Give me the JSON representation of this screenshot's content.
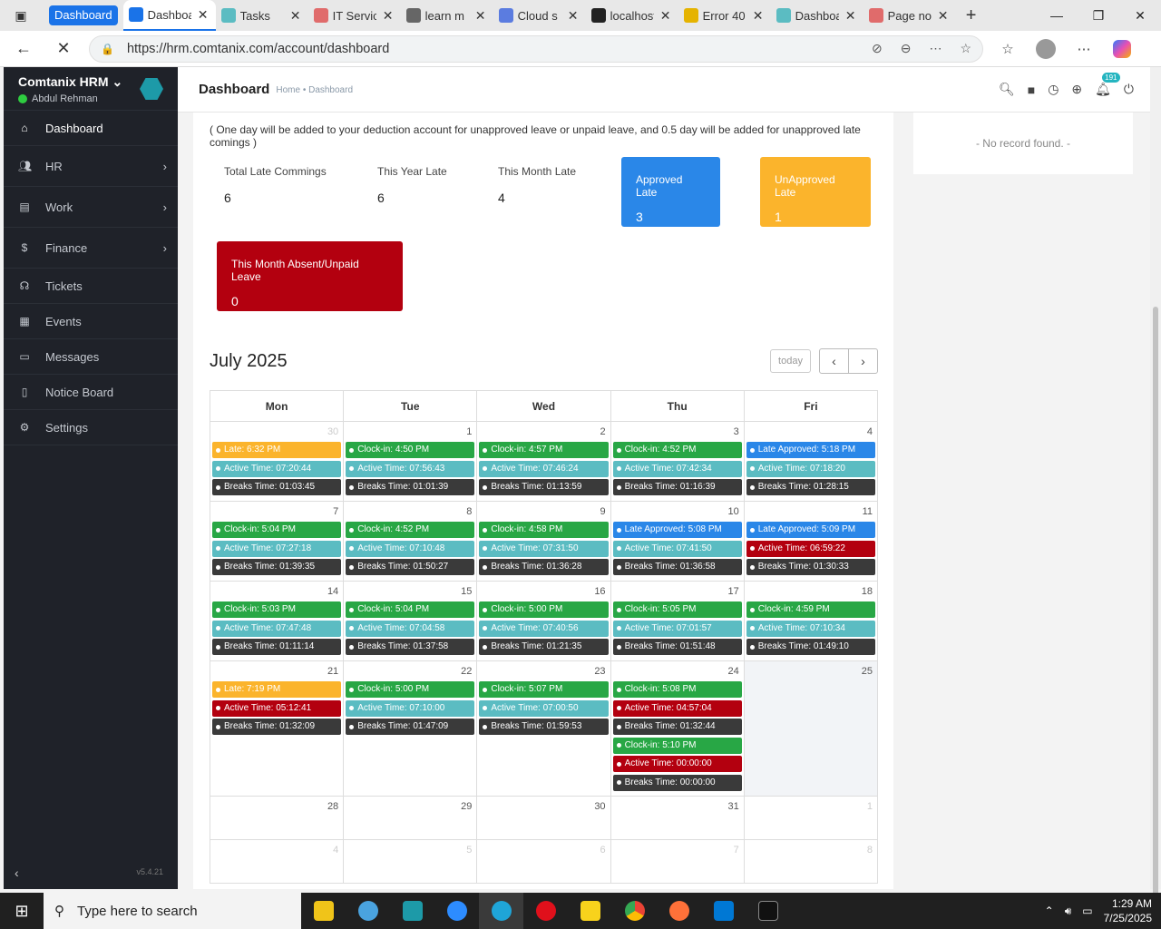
{
  "browser": {
    "tab_group_label": "Dashboard",
    "tabs": [
      {
        "label": "Dashboard",
        "icon": "dashboard-favicon",
        "active": true
      },
      {
        "label": "Tasks",
        "icon": "tasks-favicon"
      },
      {
        "label": "IT Service",
        "icon": "it-service-favicon"
      },
      {
        "label": "learn m",
        "icon": "learn-favicon"
      },
      {
        "label": "Cloud s",
        "icon": "cloud-favicon"
      },
      {
        "label": "localhost",
        "icon": "github-favicon"
      },
      {
        "label": "Error 40",
        "icon": "error-favicon"
      },
      {
        "label": "Dashboard",
        "icon": "dashboard-favicon-2"
      },
      {
        "label": "Page no",
        "icon": "page-favicon"
      }
    ],
    "url": "https://hrm.comtanix.com/account/dashboard"
  },
  "sidebar": {
    "app_name": "Comtanix HRM",
    "user_name": "Abdul Rehman",
    "items": [
      {
        "label": "Dashboard",
        "icon": "home-icon",
        "active": true
      },
      {
        "label": "HR",
        "icon": "users-icon",
        "submenu": true
      },
      {
        "label": "Work",
        "icon": "briefcase-icon",
        "submenu": true
      },
      {
        "label": "Finance",
        "icon": "dollar-icon",
        "submenu": true
      },
      {
        "label": "Tickets",
        "icon": "headset-icon"
      },
      {
        "label": "Events",
        "icon": "calendar-icon"
      },
      {
        "label": "Messages",
        "icon": "message-icon"
      },
      {
        "label": "Notice Board",
        "icon": "clipboard-icon"
      },
      {
        "label": "Settings",
        "icon": "gear-icon"
      }
    ],
    "version": "v5.4.21"
  },
  "header": {
    "title": "Dashboard",
    "breadcrumb": "Home • Dashboard",
    "notification_count": "191"
  },
  "right_panel": {
    "empty_text": "- No record found. -"
  },
  "attendance": {
    "note": "( One day will be added to your deduction account for unapproved leave or unpaid leave, and 0.5 day will be added for unapproved late comings )",
    "stats": [
      {
        "label": "Total Late Commings",
        "value": "6"
      },
      {
        "label": "This Year Late",
        "value": "6"
      },
      {
        "label": "This Month Late",
        "value": "4"
      }
    ],
    "approved_late": {
      "label": "Approved Late",
      "value": "3",
      "color": "#2a87e8"
    },
    "unapproved_late": {
      "label": "UnApproved Late",
      "value": "1",
      "color": "#fbb42c"
    },
    "absent": {
      "label": "This Month Absent/Unpaid Leave",
      "value": "0",
      "color": "#b3000f"
    }
  },
  "calendar": {
    "title": "July 2025",
    "today_label": "today",
    "weekdays": [
      "Mon",
      "Tue",
      "Wed",
      "Thu",
      "Fri"
    ],
    "colors": {
      "green": "#28a745",
      "teal": "#5bbcc2",
      "dark": "#3a3a3a",
      "yellow": "#fbb42c",
      "blue": "#2a87e8",
      "red": "#b3000f"
    },
    "weeks": [
      [
        {
          "day": "30",
          "other": true,
          "events": [
            [
              "Late: 6:32 PM",
              "yellow"
            ],
            [
              "Active Time: 07:20:44",
              "teal"
            ],
            [
              "Breaks Time: 01:03:45",
              "dark"
            ]
          ]
        },
        {
          "day": "1",
          "events": [
            [
              "Clock-in: 4:50 PM",
              "green"
            ],
            [
              "Active Time: 07:56:43",
              "teal"
            ],
            [
              "Breaks Time: 01:01:39",
              "dark"
            ]
          ]
        },
        {
          "day": "2",
          "events": [
            [
              "Clock-in: 4:57 PM",
              "green"
            ],
            [
              "Active Time: 07:46:24",
              "teal"
            ],
            [
              "Breaks Time: 01:13:59",
              "dark"
            ]
          ]
        },
        {
          "day": "3",
          "events": [
            [
              "Clock-in: 4:52 PM",
              "green"
            ],
            [
              "Active Time: 07:42:34",
              "teal"
            ],
            [
              "Breaks Time: 01:16:39",
              "dark"
            ]
          ]
        },
        {
          "day": "4",
          "events": [
            [
              "Late Approved: 5:18 PM",
              "blue"
            ],
            [
              "Active Time: 07:18:20",
              "teal"
            ],
            [
              "Breaks Time: 01:28:15",
              "dark"
            ]
          ]
        }
      ],
      [
        {
          "day": "7",
          "events": [
            [
              "Clock-in: 5:04 PM",
              "green"
            ],
            [
              "Active Time: 07:27:18",
              "teal"
            ],
            [
              "Breaks Time: 01:39:35",
              "dark"
            ]
          ]
        },
        {
          "day": "8",
          "events": [
            [
              "Clock-in: 4:52 PM",
              "green"
            ],
            [
              "Active Time: 07:10:48",
              "teal"
            ],
            [
              "Breaks Time: 01:50:27",
              "dark"
            ]
          ]
        },
        {
          "day": "9",
          "events": [
            [
              "Clock-in: 4:58 PM",
              "green"
            ],
            [
              "Active Time: 07:31:50",
              "teal"
            ],
            [
              "Breaks Time: 01:36:28",
              "dark"
            ]
          ]
        },
        {
          "day": "10",
          "events": [
            [
              "Late Approved: 5:08 PM",
              "blue"
            ],
            [
              "Active Time: 07:41:50",
              "teal"
            ],
            [
              "Breaks Time: 01:36:58",
              "dark"
            ]
          ]
        },
        {
          "day": "11",
          "events": [
            [
              "Late Approved: 5:09 PM",
              "blue"
            ],
            [
              "Active Time: 06:59:22",
              "red"
            ],
            [
              "Breaks Time: 01:30:33",
              "dark"
            ]
          ]
        }
      ],
      [
        {
          "day": "14",
          "events": [
            [
              "Clock-in: 5:03 PM",
              "green"
            ],
            [
              "Active Time: 07:47:48",
              "teal"
            ],
            [
              "Breaks Time: 01:11:14",
              "dark"
            ]
          ]
        },
        {
          "day": "15",
          "events": [
            [
              "Clock-in: 5:04 PM",
              "green"
            ],
            [
              "Active Time: 07:04:58",
              "teal"
            ],
            [
              "Breaks Time: 01:37:58",
              "dark"
            ]
          ]
        },
        {
          "day": "16",
          "events": [
            [
              "Clock-in: 5:00 PM",
              "green"
            ],
            [
              "Active Time: 07:40:56",
              "teal"
            ],
            [
              "Breaks Time: 01:21:35",
              "dark"
            ]
          ]
        },
        {
          "day": "17",
          "events": [
            [
              "Clock-in: 5:05 PM",
              "green"
            ],
            [
              "Active Time: 07:01:57",
              "teal"
            ],
            [
              "Breaks Time: 01:51:48",
              "dark"
            ]
          ]
        },
        {
          "day": "18",
          "events": [
            [
              "Clock-in: 4:59 PM",
              "green"
            ],
            [
              "Active Time: 07:10:34",
              "teal"
            ],
            [
              "Breaks Time: 01:49:10",
              "dark"
            ]
          ]
        }
      ],
      [
        {
          "day": "21",
          "events": [
            [
              "Late: 7:19 PM",
              "yellow"
            ],
            [
              "Active Time: 05:12:41",
              "red"
            ],
            [
              "Breaks Time: 01:32:09",
              "dark"
            ]
          ]
        },
        {
          "day": "22",
          "events": [
            [
              "Clock-in: 5:00 PM",
              "green"
            ],
            [
              "Active Time: 07:10:00",
              "teal"
            ],
            [
              "Breaks Time: 01:47:09",
              "dark"
            ]
          ]
        },
        {
          "day": "23",
          "events": [
            [
              "Clock-in: 5:07 PM",
              "green"
            ],
            [
              "Active Time: 07:00:50",
              "teal"
            ],
            [
              "Breaks Time: 01:59:53",
              "dark"
            ]
          ]
        },
        {
          "day": "24",
          "events": [
            [
              "Clock-in: 5:08 PM",
              "green"
            ],
            [
              "Active Time: 04:57:04",
              "red"
            ],
            [
              "Breaks Time: 01:32:44",
              "dark"
            ],
            [
              "Clock-in: 5:10 PM",
              "green"
            ],
            [
              "Active Time: 00:00:00",
              "red"
            ],
            [
              "Breaks Time: 00:00:00",
              "dark"
            ]
          ]
        },
        {
          "day": "25",
          "today": true,
          "events": []
        }
      ],
      [
        {
          "day": "28",
          "events": []
        },
        {
          "day": "29",
          "events": []
        },
        {
          "day": "30",
          "events": []
        },
        {
          "day": "31",
          "events": []
        },
        {
          "day": "1",
          "other": true,
          "events": []
        }
      ],
      [
        {
          "day": "4",
          "other": true,
          "events": []
        },
        {
          "day": "5",
          "other": true,
          "events": []
        },
        {
          "day": "6",
          "other": true,
          "events": []
        },
        {
          "day": "7",
          "other": true,
          "events": []
        },
        {
          "day": "8",
          "other": true,
          "events": []
        }
      ]
    ]
  },
  "taskbar": {
    "search_placeholder": "Type here to search",
    "time": "1:29 AM",
    "date": "7/25/2025"
  }
}
